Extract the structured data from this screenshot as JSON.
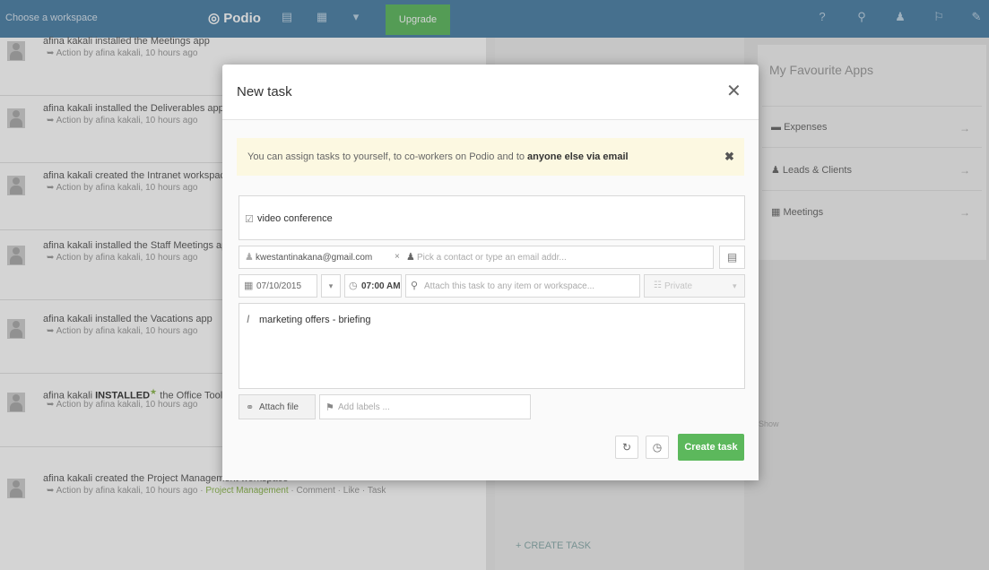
{
  "topbar": {
    "workspace_label": "Choose a workspace",
    "logo": "Podio",
    "upgrade": "Upgrade"
  },
  "activity": [
    {
      "title": "afina kakali installed the Meetings app",
      "sub": "Action by afina kakali, 10 hours ago"
    },
    {
      "title": "afina kakali installed the Deliverables app",
      "sub": "Action by afina kakali, 10 hours ago"
    },
    {
      "title": "afina kakali created the Intranet workspace",
      "sub": "Action by afina kakali, 10 hours ago"
    },
    {
      "title": "afina kakali installed the Staff Meetings app",
      "sub": "Action by afina kakali, 10 hours ago"
    },
    {
      "title": "afina kakali installed the Vacations app",
      "sub": "Action by afina kakali, 10 hours ago"
    },
    {
      "title_pre": "afina kakali",
      "title_bold": "INSTALLED",
      "title_post": "the Office Tools pack",
      "sub": "Action by afina kakali, 10 hours ago"
    },
    {
      "title": "afina kakali created the Project Management workspace",
      "sub": "Action by afina kakali, 10 hours ago · ",
      "sub_link": "Project Management",
      "sub_tail": " · Comment · Like · Task"
    }
  ],
  "right_panel": {
    "heading": "My Favourite Apps",
    "items": [
      "Expenses",
      "Leads & Clients",
      "Meetings"
    ],
    "show_text": "Show"
  },
  "middle": {
    "create_task": "+ CREATE TASK"
  },
  "modal": {
    "title": "New task",
    "tip_pre": "You can assign tasks to yourself, to co-workers on Podio and to ",
    "tip_bold": "anyone else via email",
    "task_title": "video conference",
    "assignee": "kwestantinakana@gmail.com",
    "assign_placeholder": "Pick a contact or type an email addr...",
    "due_date": "07/10/2015",
    "due_time": "07:00 AM",
    "attach_placeholder": "Attach this task to any item or workspace...",
    "privacy": "Private",
    "description": "marketing offers - briefing",
    "attach_file": "Attach file",
    "labels_placeholder": "Add labels ...",
    "create_button": "Create task"
  }
}
